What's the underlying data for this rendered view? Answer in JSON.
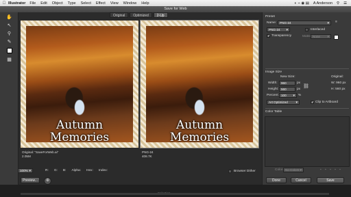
{
  "menubar": {
    "app": "Illustrator",
    "items": [
      "File",
      "Edit",
      "Object",
      "Type",
      "Select",
      "Effect",
      "View",
      "Window",
      "Help"
    ],
    "user": "A Anderson"
  },
  "dialog": {
    "title": "Save for Web"
  },
  "tabs": [
    {
      "label": "Original",
      "active": false
    },
    {
      "label": "Optimized",
      "active": false
    },
    {
      "label": "2-Up",
      "active": true
    }
  ],
  "panes": {
    "left": {
      "caption_line1": "Autumn",
      "caption_line2": "Memories",
      "info_line1": "Original: \"SaveForWeb.ai\"",
      "info_line2": "2.05M"
    },
    "right": {
      "caption_line1": "Autumn",
      "caption_line2": "Memories",
      "info_line1": "PNG-24",
      "info_line2": "408.7K"
    }
  },
  "preset": {
    "heading": "Preset",
    "name_label": "Name:",
    "name_value": "PNG-24",
    "format_value": "PNG-24",
    "interlaced_label": "Interlaced",
    "interlaced_checked": false,
    "transparency_label": "Transparency",
    "transparency_checked": true,
    "matte_label": "Matte:",
    "matte_value": "None"
  },
  "image_size": {
    "heading": "Image Size",
    "new_size_label": "New Size:",
    "original_label": "Original:",
    "width_label": "Width:",
    "width_value": "960",
    "height_label": "Height:",
    "height_value": "560",
    "unit": "px",
    "original_w": "W:  960 px",
    "original_h": "H:  560 px",
    "percent_label": "Percent:",
    "percent_value": "100",
    "percent_unit": "%",
    "optimize_value": "Art Optimized",
    "clip_label": "Clip to Artboard",
    "clip_checked": true
  },
  "color_table": {
    "heading": "Color Table",
    "colors_label": "Colors:",
    "colors_value": "No Colors"
  },
  "statusbar": {
    "zoom": "100%",
    "r_label": "R:",
    "g_label": "G:",
    "b_label": "B:",
    "alpha_label": "Alpha:",
    "hex_label": "Hex:",
    "index_label": "Index:"
  },
  "buttons": {
    "preview": "Preview...",
    "browser_dither": "Browser Dither",
    "done": "Done",
    "cancel": "Cancel",
    "save": "Save"
  },
  "footer": {
    "selection": "Selection"
  },
  "icons": [
    "apple-icon",
    "hand-tool-icon",
    "slice-select-icon",
    "zoom-icon",
    "eyedropper-icon",
    "color-swatch-icon",
    "toggle-slices-icon",
    "globe-icon",
    "menu-icon",
    "link-icon",
    "check-icon"
  ]
}
